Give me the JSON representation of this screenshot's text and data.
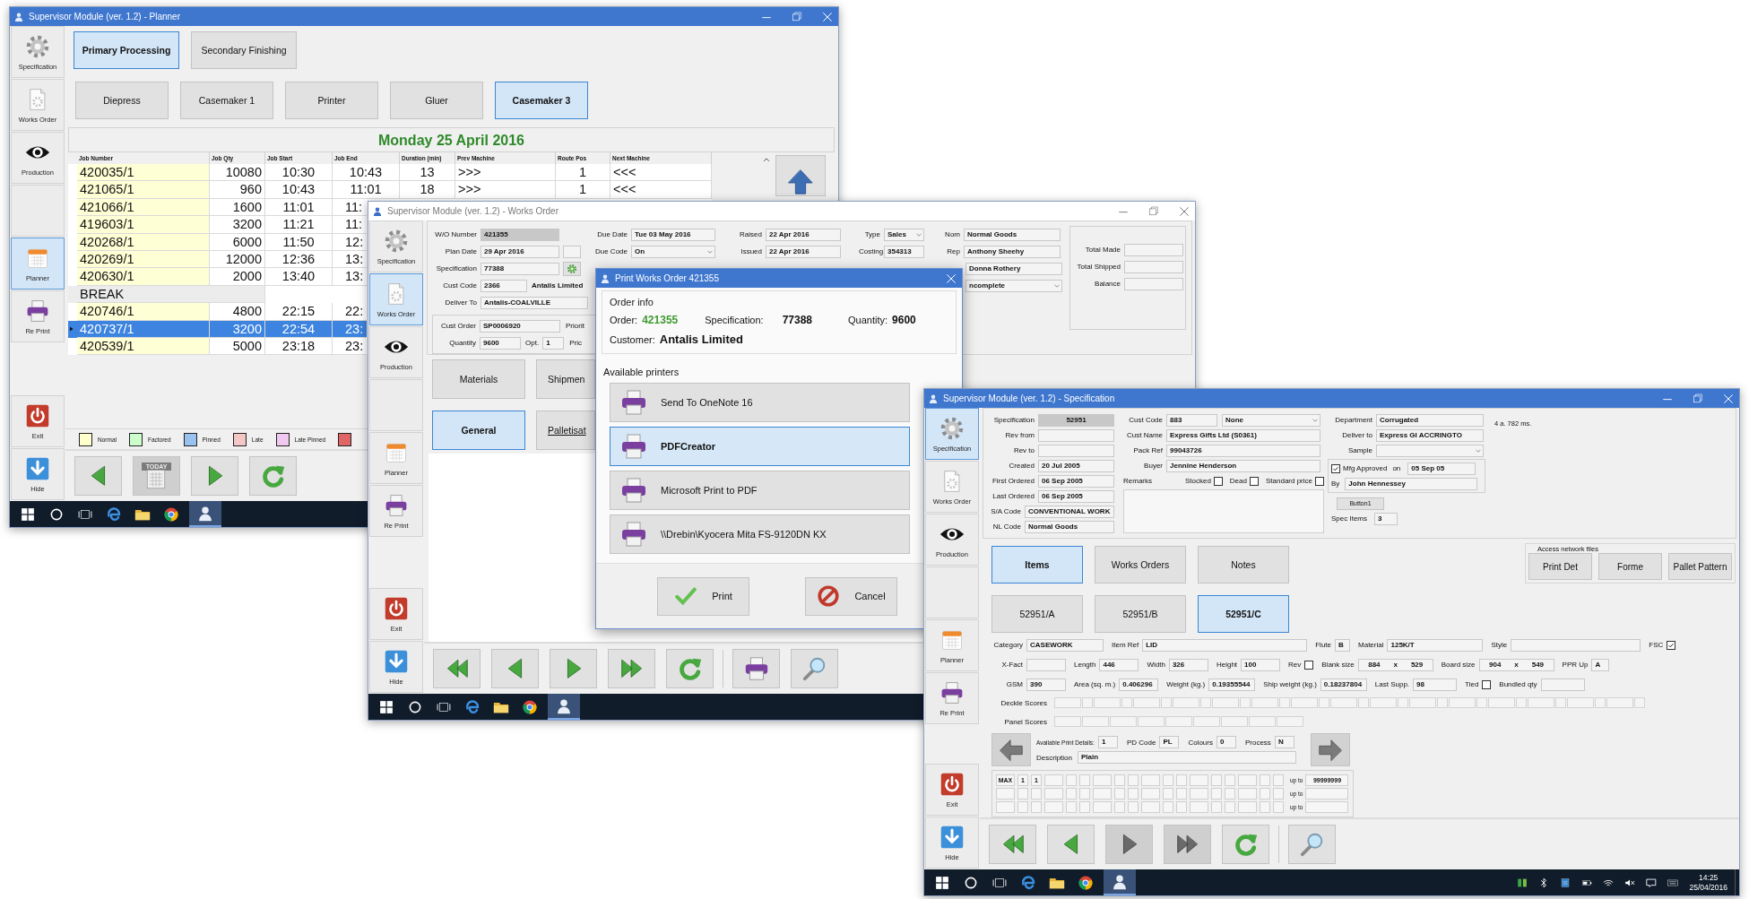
{
  "planner": {
    "title": "Supervisor Module (ver. 1.2) - Planner",
    "active": true,
    "sidebar": [
      {
        "label": "Specification",
        "selected": false
      },
      {
        "label": "Works Order",
        "selected": false
      },
      {
        "label": "Production",
        "selected": false
      },
      {
        "label": "Planner",
        "selected": true
      },
      {
        "label": "Re Print",
        "selected": false
      },
      {
        "label": "Exit",
        "selected": false
      },
      {
        "label": "Hide",
        "selected": false
      }
    ],
    "tabs": [
      {
        "label": "Primary Processing",
        "selected": true
      },
      {
        "label": "Secondary Finishing",
        "selected": false
      }
    ],
    "machines": [
      {
        "label": "Diepress",
        "selected": false
      },
      {
        "label": "Casemaker 1",
        "selected": false
      },
      {
        "label": "Printer",
        "selected": false
      },
      {
        "label": "Gluer",
        "selected": false
      },
      {
        "label": "Casemaker 3",
        "selected": true
      }
    ],
    "date": "Monday 25 April 2016",
    "table": {
      "columns": [
        "Job Number",
        "Job Qty",
        "Job Start",
        "Job End",
        "Duration (min)",
        "Prev Machine",
        "Route Pos",
        "Next Machine"
      ],
      "rows": [
        {
          "kind": "job",
          "selected": false,
          "cells": [
            "420035/1",
            "10080",
            "10:30",
            "10:43",
            "13",
            ">>>",
            "1",
            "<<<"
          ]
        },
        {
          "kind": "job",
          "selected": false,
          "cells": [
            "421065/1",
            "960",
            "10:43",
            "11:01",
            "18",
            ">>>",
            "1",
            "<<<"
          ]
        },
        {
          "kind": "job",
          "selected": false,
          "cells": [
            "421066/1",
            "1600",
            "11:01",
            "11:"
          ]
        },
        {
          "kind": "job",
          "selected": false,
          "cells": [
            "419603/1",
            "3200",
            "11:21",
            "11:"
          ]
        },
        {
          "kind": "job",
          "selected": false,
          "cells": [
            "420268/1",
            "6000",
            "11:50",
            "12:"
          ]
        },
        {
          "kind": "job",
          "selected": false,
          "cells": [
            "420269/1",
            "12000",
            "12:36",
            "13:"
          ]
        },
        {
          "kind": "job",
          "selected": false,
          "cells": [
            "420630/1",
            "2000",
            "13:40",
            "13:"
          ]
        },
        {
          "kind": "break",
          "selected": false,
          "cells": [
            "BREAK"
          ]
        },
        {
          "kind": "job",
          "selected": false,
          "cells": [
            "420746/1",
            "4800",
            "22:15",
            "22:"
          ]
        },
        {
          "kind": "job",
          "selected": true,
          "cells": [
            "420737/1",
            "3200",
            "22:54",
            "23:"
          ]
        },
        {
          "kind": "job",
          "selected": false,
          "cells": [
            "420539/1",
            "5000",
            "23:18",
            "23:"
          ]
        }
      ]
    },
    "legend": [
      {
        "label": "Normal",
        "color": "#ffffcc"
      },
      {
        "label": "Factored",
        "color": "#ccffcc"
      },
      {
        "label": "Pinned",
        "color": "#99c2f0"
      },
      {
        "label": "Late",
        "color": "#f4c6c6"
      },
      {
        "label": "Late Pinned",
        "color": "#f0c8f0"
      },
      {
        "color": "#e06666"
      }
    ],
    "toolbar": [
      {
        "kind": "prev",
        "disabled": false
      },
      {
        "kind": "today",
        "label": "TODAY",
        "disabled": true
      },
      {
        "kind": "next",
        "disabled": false
      },
      {
        "kind": "refresh",
        "disabled": false
      }
    ]
  },
  "works_order": {
    "title": "Supervisor Module (ver. 1.2) - Works Order",
    "active": false,
    "sidebar": [
      {
        "label": "Specification",
        "selected": false
      },
      {
        "label": "Works Order",
        "selected": true
      },
      {
        "label": "Production",
        "selected": false
      },
      {
        "label": "Planner",
        "selected": false
      },
      {
        "label": "Re Print",
        "selected": false
      },
      {
        "label": "Exit",
        "selected": false
      },
      {
        "label": "Hide",
        "selected": false
      }
    ],
    "form": {
      "wo_number": {
        "label": "W/O Number",
        "value": "421355"
      },
      "plan_date": {
        "label": "Plan Date",
        "value": "29 Apr 2016"
      },
      "specification": {
        "label": "Specification",
        "value": "77388"
      },
      "cust_code": {
        "label": "Cust Code",
        "value": "2366",
        "name": "Antalis Limited"
      },
      "deliver_to": {
        "label": "Deliver To",
        "value": "Antalis-COALVILLE"
      },
      "cust_order": {
        "label": "Cust Order",
        "value": "SP0006920",
        "next_label": "Priorit"
      },
      "quantity": {
        "label": "Quantity",
        "value": "9600",
        "opt_label": "Opt.",
        "opt": "1",
        "next_label": "Pric"
      },
      "due_date": {
        "label": "Due Date",
        "value": "Tue 03 May 2016"
      },
      "due_code": {
        "label": "Due Code",
        "value": "On"
      },
      "raised": {
        "label": "Raised",
        "value": "22 Apr 2016"
      },
      "issued": {
        "label": "Issued",
        "value": "22 Apr 2016"
      },
      "type": {
        "label": "Type",
        "value": "Sales"
      },
      "costing": {
        "label": "Costing",
        "value": "354313"
      },
      "nom": {
        "label": "Nom",
        "value": "Normal Goods"
      },
      "rep": {
        "label": "Rep",
        "value": "Anthony Sheehy"
      },
      "contact": "Donna Rothery",
      "status": "ncomplete",
      "totals": [
        {
          "label": "Total Made"
        },
        {
          "label": "Total Shipped"
        },
        {
          "label": "Balance"
        }
      ]
    },
    "tabs": [
      {
        "label": "Materials",
        "selected": false
      },
      {
        "label": "Shipmen",
        "selected": false
      },
      {
        "label": "General",
        "selected": true
      },
      {
        "label": "Palletisat",
        "selected": false
      }
    ],
    "toolbar": [
      {
        "kind": "first",
        "disabled": false
      },
      {
        "kind": "prev",
        "disabled": false
      },
      {
        "kind": "next",
        "disabled": false
      },
      {
        "kind": "last",
        "disabled": false
      },
      {
        "kind": "refresh",
        "disabled": false
      },
      {
        "kind": "print",
        "disabled": false
      },
      {
        "kind": "search",
        "disabled": false
      }
    ],
    "print_dialog": {
      "title": "Print Works Order 421355",
      "order_info": {
        "title": "Order info",
        "order": {
          "label": "Order:",
          "value": "421355"
        },
        "specification": {
          "label": "Specification:",
          "value": "77388"
        },
        "quantity": {
          "label": "Quantity:",
          "value": "9600"
        },
        "customer": {
          "label": "Customer:",
          "value": "Antalis Limited"
        }
      },
      "printers_title": "Available printers",
      "printers": [
        {
          "name": "Send To OneNote 16",
          "selected": false
        },
        {
          "name": "PDFCreator",
          "selected": true
        },
        {
          "name": "Microsoft Print to PDF",
          "selected": false
        },
        {
          "name": "\\\\Drebin\\Kyocera Mita FS-9120DN KX",
          "selected": false
        }
      ],
      "buttons": [
        {
          "kind": "print",
          "label": "Print"
        },
        {
          "kind": "cancel",
          "label": "Cancel"
        }
      ]
    }
  },
  "specification": {
    "title": "Supervisor Module (ver. 1.2) - Specification",
    "active": true,
    "sidebar": [
      {
        "label": "Specification",
        "selected": true
      },
      {
        "label": "Works Order",
        "selected": false
      },
      {
        "label": "Production",
        "selected": false
      },
      {
        "label": "Planner",
        "selected": false
      },
      {
        "label": "Re Print",
        "selected": false
      },
      {
        "label": "Exit",
        "selected": false
      },
      {
        "label": "Hide",
        "selected": false
      }
    ],
    "header": {
      "col_1": [
        {
          "label": "Specification",
          "value": "52951"
        },
        {
          "label": "Rev from"
        },
        {
          "label": "Rev to"
        },
        {
          "label": "Created",
          "value": "20 Jul 2005"
        },
        {
          "label": "First Ordered",
          "value": "06 Sep 2005"
        },
        {
          "label": "Last Ordered",
          "value": "06 Sep 2005"
        },
        {
          "label": "S/A Code",
          "value": "CONVENTIONAL WORK"
        },
        {
          "label": "NL Code",
          "value": "Normal Goods"
        }
      ],
      "cust_code": {
        "label": "Cust Code",
        "value": "883",
        "option": "None"
      },
      "col_2": [
        {
          "label": "Cust Name",
          "value": "Express Gifts Ltd (S0361)"
        },
        {
          "label": "Pack Ref",
          "value": "99043726"
        },
        {
          "label": "Buyer",
          "value": "Jennine Henderson"
        }
      ],
      "remarks_label": "Remarks",
      "flags": [
        {
          "label": "Stocked",
          "checked": false
        },
        {
          "label": "Dead",
          "checked": false
        },
        {
          "label": "Standard price",
          "checked": false
        }
      ],
      "col_3": [
        {
          "label": "Department",
          "value": "Corrugated"
        },
        {
          "label": "Deliver to",
          "value": "Express GI ACCRINGTO"
        }
      ],
      "sample": {
        "label": "Sample"
      },
      "mfg_approved": {
        "label": "Mfg Approved",
        "checked": true,
        "on_label": "on",
        "date": "05 Sep 05",
        "by_label": "By",
        "by": "John Hennessey"
      },
      "button": "Button1",
      "spec_items": {
        "label": "Spec Items",
        "value": "3"
      },
      "timing": "4 a. 782 ms."
    },
    "tabs": [
      {
        "label": "Items",
        "selected": true
      },
      {
        "label": "Works Orders",
        "selected": false
      },
      {
        "label": "Notes",
        "selected": false
      }
    ],
    "network_files": {
      "title": "Access network files",
      "buttons": [
        "Print Det",
        "Forme",
        "Pallet Pattern"
      ]
    },
    "items": [
      {
        "label": "52951/A",
        "selected": false
      },
      {
        "label": "52951/B",
        "selected": false
      },
      {
        "label": "52951/C",
        "selected": true
      }
    ],
    "item_rows": [
      [
        {
          "kind": "field",
          "label": "Category",
          "value": "CASEWORK"
        },
        {
          "kind": "field",
          "label": "Item Ref",
          "value": "LID"
        },
        {
          "kind": "field",
          "label": "Flute",
          "value": "B"
        },
        {
          "kind": "field",
          "label": "Material",
          "value": "125K/T"
        },
        {
          "kind": "field",
          "label": "Style"
        },
        {
          "kind": "check",
          "label": "FSC",
          "checked": true
        }
      ],
      [
        {
          "kind": "field",
          "label": "X-Fact"
        },
        {
          "kind": "field",
          "label": "Length",
          "value": "446"
        },
        {
          "kind": "field",
          "label": "Width",
          "value": "326"
        },
        {
          "kind": "field",
          "label": "Height",
          "value": "100"
        },
        {
          "kind": "check",
          "label": "Rev",
          "checked": false
        },
        {
          "kind": "size",
          "label": "Blank size",
          "value": "884",
          "sep": "x",
          "value_2": "529"
        },
        {
          "kind": "size",
          "label": "Board size",
          "value": "904",
          "sep": "x",
          "value_2": "549"
        },
        {
          "kind": "field",
          "label": "PPR Up",
          "value": "A"
        }
      ],
      [
        {
          "kind": "field",
          "label": "GSM",
          "value": "390"
        },
        {
          "kind": "field",
          "label": "Area (sq. m.)",
          "value": "0.406296"
        },
        {
          "kind": "field",
          "label": "Weight (kg.)",
          "value": "0.19355544"
        },
        {
          "kind": "field",
          "label": "Ship weight (kg.)",
          "value": "0.18237804"
        },
        {
          "kind": "field",
          "label": "Last Supp.",
          "value": "98"
        },
        {
          "kind": "check",
          "label": "Tied",
          "checked": false
        },
        {
          "kind": "field",
          "label": "Bundled qty"
        }
      ]
    ],
    "scores": [
      {
        "label": "Deckle Scores"
      },
      {
        "label": "Panel Scores"
      }
    ],
    "print_details": {
      "fields": [
        {
          "label": "Available Print Details:",
          "value": "1"
        },
        {
          "label": "PD Code",
          "value": "PL"
        },
        {
          "label": "Colours",
          "value": "0"
        },
        {
          "label": "Process",
          "value": "N"
        }
      ],
      "description": {
        "label": "Description",
        "value": "Plain"
      }
    },
    "print_grid": [
      {
        "cells": [
          "MAX",
          "1",
          "1"
        ],
        "label": "up to",
        "value": "99999999"
      },
      {
        "label": "up to"
      },
      {
        "label": "up to"
      }
    ],
    "toolbar": [
      {
        "kind": "first",
        "disabled": false
      },
      {
        "kind": "prev",
        "disabled": false
      },
      {
        "kind": "next",
        "disabled": true
      },
      {
        "kind": "last",
        "disabled": true
      },
      {
        "kind": "refresh",
        "disabled": false
      },
      {
        "kind": "search",
        "disabled": false
      }
    ],
    "taskbar": {
      "time": "14:25",
      "date": "25/04/2016"
    }
  }
}
